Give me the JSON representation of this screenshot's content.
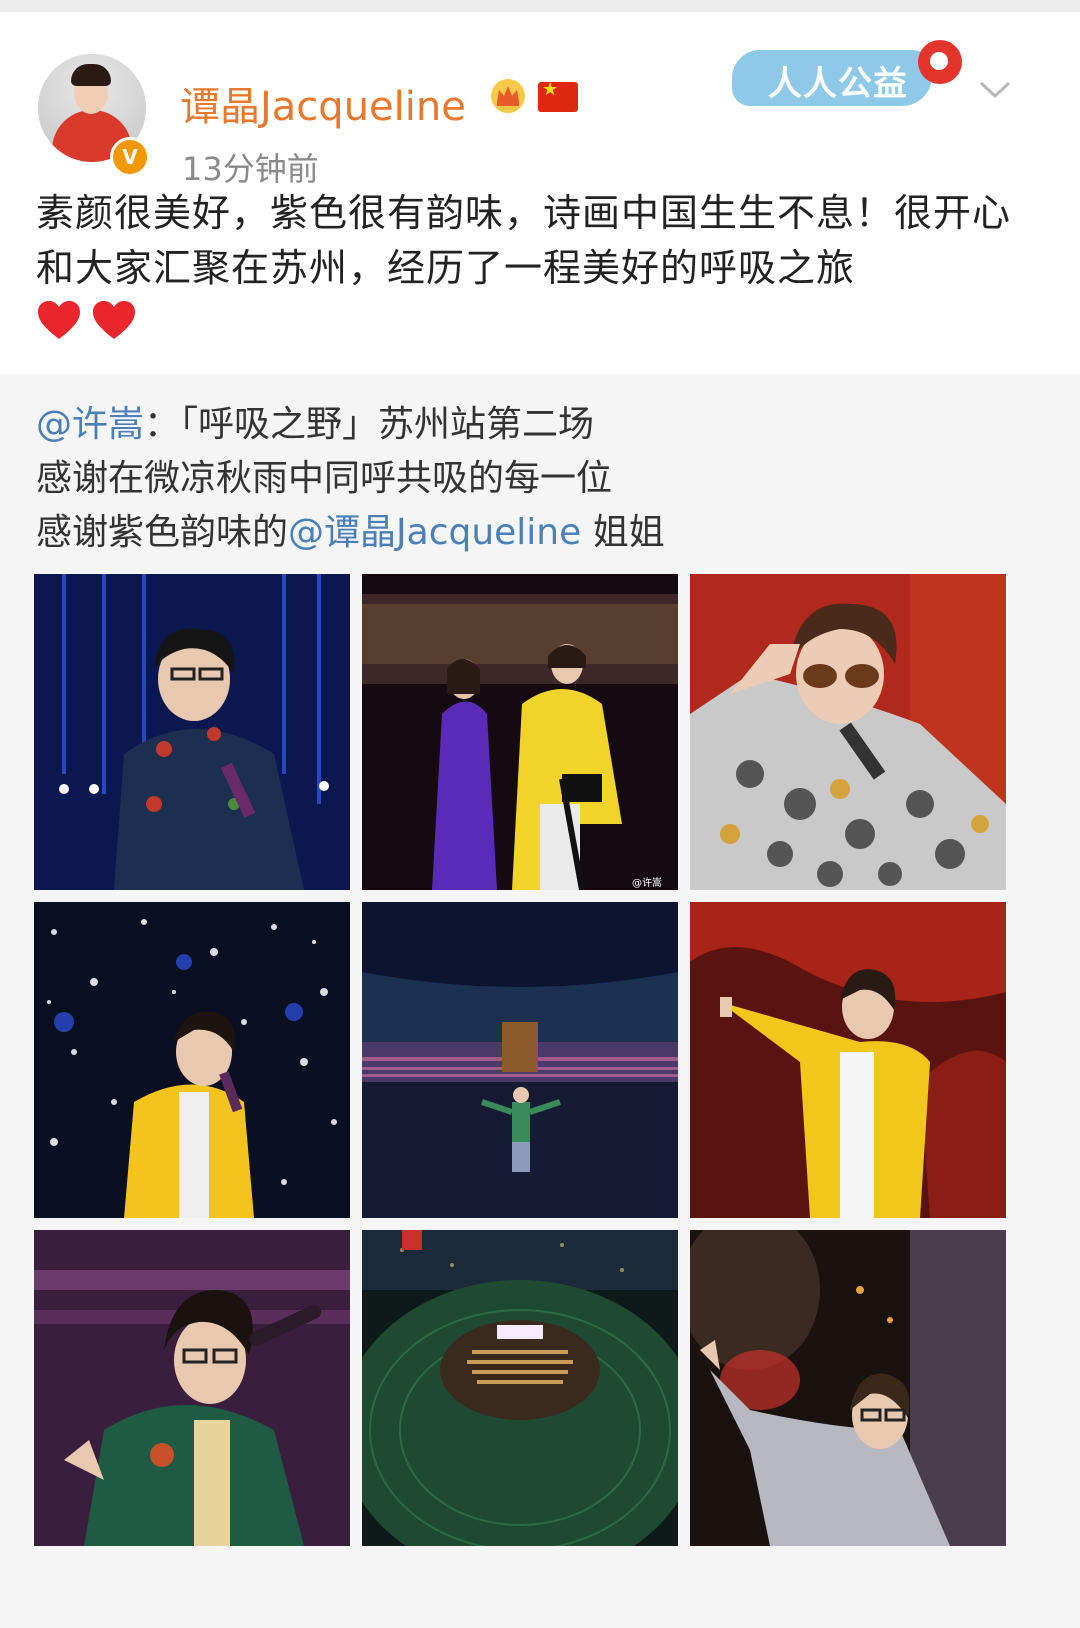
{
  "header": {
    "username": "谭晶Jacqueline",
    "timestamp": "13分钟前",
    "verified_badge": "V",
    "charity_badge": "人人公益",
    "icons": [
      "crown-icon",
      "china-flag-icon",
      "chevron-down-icon"
    ]
  },
  "post": {
    "text": "素颜很美好，紫色很有韵味，诗画中国生生不息！很开心和大家汇聚在苏州，经历了一程美好的呼吸之旅",
    "emoji": [
      "heart-icon",
      "heart-icon"
    ]
  },
  "repost": {
    "mention_author": "@许嵩",
    "line1_rest": "：「呼吸之野」苏州站第二场",
    "line2": "感谢在微凉秋雨中同呼共吸的每一位",
    "line3_prefix": "感谢紫色韵味的",
    "line3_mention": "@谭晶Jacqueline",
    "line3_suffix": " 姐姐",
    "photo_watermark": "@许嵩",
    "photos": [
      "singer-floral-shirt-blue-stage",
      "duet-purple-yellow-suits",
      "singer-sunglasses-sequins-red",
      "singer-yellow-jacket-snow",
      "stadium-crowd-wide-shot",
      "singer-yellow-jacket-red-backdrop",
      "singer-green-jacket-mic",
      "aerial-stadium-night",
      "singer-silver-shirt-wave"
    ]
  },
  "colors": {
    "username": "#e8782e",
    "mention": "#4a7fb8",
    "repost_bg": "#f5f5f5",
    "verified": "#f39800"
  }
}
